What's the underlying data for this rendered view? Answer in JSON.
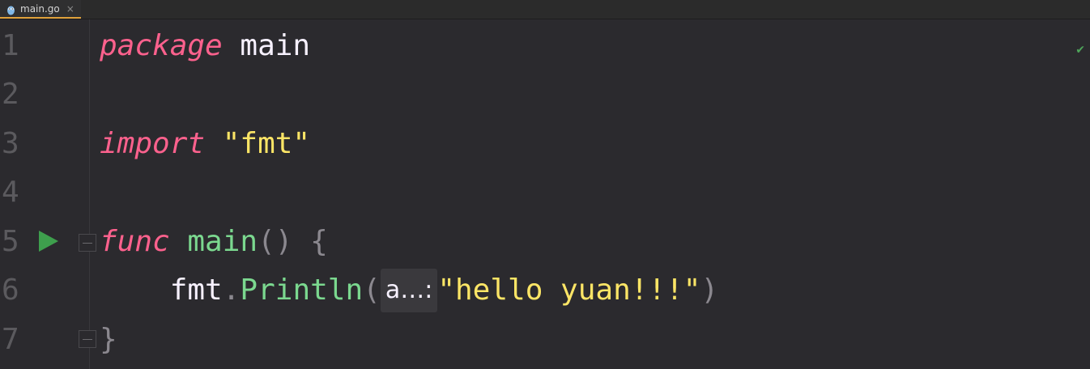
{
  "tab": {
    "filename": "main.go",
    "close_glyph": "×",
    "accent": "#e0a13c"
  },
  "editor": {
    "status_icon": "check-icon",
    "status_glyph": "✔",
    "lines": [
      {
        "number": "1"
      },
      {
        "number": "2"
      },
      {
        "number": "3"
      },
      {
        "number": "4"
      },
      {
        "number": "5"
      },
      {
        "number": "6"
      },
      {
        "number": "7"
      }
    ],
    "code": {
      "l1_kw": "package",
      "l1_name": " main",
      "l3_kw": "import",
      "l3_str": " \"fmt\"",
      "l5_kw": "func",
      "l5_fn": " main",
      "l5_rest": "() {",
      "l6_indent": "    ",
      "l6_pkg": "fmt",
      "l6_dot": ".",
      "l6_fn": "Println",
      "l6_open": "(",
      "l6_hint": "a…:",
      "l6_str": "\"hello yuan!!!\"",
      "l6_close": ")",
      "l7_brace": "}"
    }
  },
  "colors": {
    "keyword": "#fc618d",
    "string": "#fce566",
    "function": "#7bd88f",
    "background": "#2b2a2e",
    "run_icon": "#3e9f4d"
  }
}
